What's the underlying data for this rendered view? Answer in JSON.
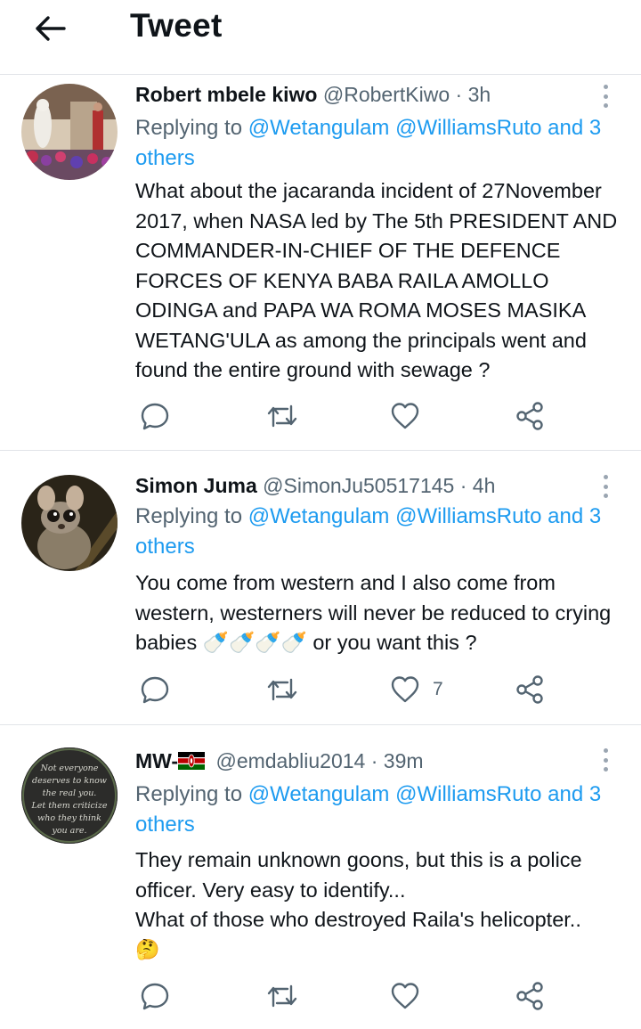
{
  "header": {
    "title": "Tweet",
    "back_icon": "arrow-left-icon"
  },
  "colors": {
    "link": "#1d9bf0",
    "secondary": "#536471",
    "text": "#0f1419",
    "divider": "#e1e4e8"
  },
  "tweets": [
    {
      "name": "Robert mbele kiwo",
      "handle": "@RobertKiwo",
      "separator": "·",
      "time": "3h",
      "replying_prefix": "Replying to ",
      "mentions": [
        "@Wetangulam",
        "@WilliamsRuto"
      ],
      "replying_suffix": " and 3 others",
      "text": "What about the jacaranda incident of 27November 2017, when NASA led by The 5th PRESIDENT AND COMMANDER-IN-CHIEF OF THE DEFENCE FORCES OF KENYA BABA RAILA AMOLLO ODINGA and  PAPA WA ROMA MOSES MASIKA WETANG'ULA as among the principals went and found the entire ground with sewage ?",
      "like_count": ""
    },
    {
      "name": "Simon Juma",
      "handle": "@SimonJu50517145",
      "separator": "·",
      "time": "4h",
      "replying_prefix": "Replying to ",
      "mentions": [
        "@Wetangulam",
        "@WilliamsRuto"
      ],
      "replying_suffix": " and 3 others",
      "text": "You come from western and I also come from western, westerners  will never be reduced to crying babies 🍼🍼🍼🍼 or you want this ?",
      "like_count": "7"
    },
    {
      "name": "MW-",
      "name_flag": "🇰🇪",
      "handle": "@emdabliu2014",
      "separator": "·",
      "time": "39m",
      "replying_prefix": "Replying to ",
      "mentions": [
        "@Wetangulam",
        "@WilliamsRuto"
      ],
      "replying_suffix": " and 3 others",
      "text_lines": [
        "They remain unknown goons, but this is a police officer. Very easy to identify...",
        "What of those who destroyed Raila's helicopter.."
      ],
      "text_emoji": "🤔",
      "avatar_text": [
        "Not everyone",
        "deserves to know",
        "the real you.",
        "Let them criticize",
        "who they think",
        "you are."
      ],
      "like_count": ""
    }
  ]
}
